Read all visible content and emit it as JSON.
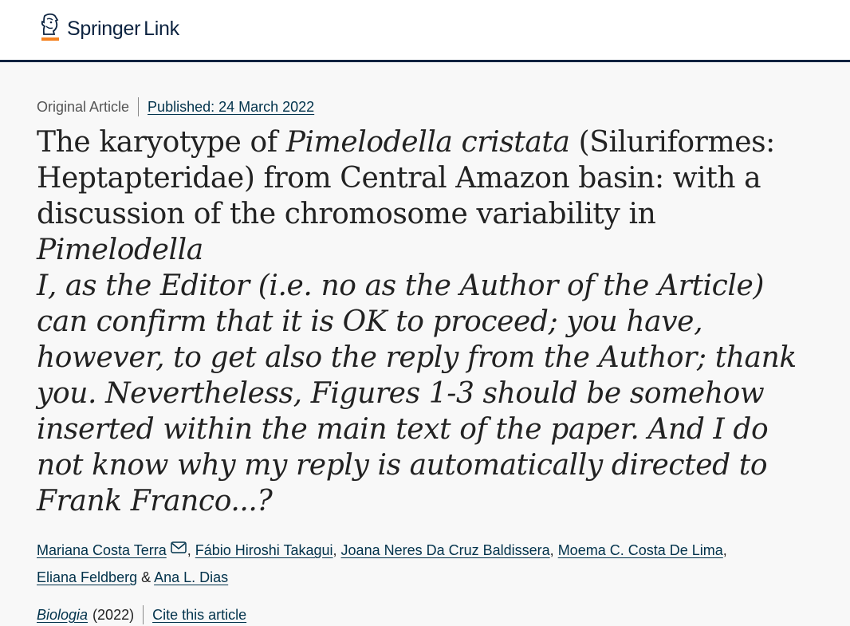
{
  "header": {
    "logo_brand": "Springer",
    "logo_suffix": "Link",
    "colors": {
      "navy": "#0c2340",
      "orange": "#f58220"
    }
  },
  "article": {
    "type": "Original Article",
    "published": "Published: 24 March 2022",
    "title_parts": {
      "p1": "The karyotype of ",
      "p2": "Pimelodella cristata",
      "p3": " (Siluriformes: Heptapteridae) from Central Amazon basin: with a discussion of the chromosome variability in ",
      "p4": "Pimelodella",
      "p5": "I, as the Editor (i.e. no as the Author of the Article) can confirm that it is OK to proceed; you have, however, to get also the reply from the Author; thank you. Nevertheless, Figures 1-3 should be somehow inserted within the main text of the paper. And I do not know why my reply is automatically directed to Frank Franco...?"
    },
    "authors": [
      "Mariana Costa Terra",
      "Fábio Hiroshi Takagui",
      "Joana Neres Da Cruz Baldissera",
      "Moema C. Costa De Lima",
      "Eliana Feldberg",
      "Ana L. Dias"
    ],
    "author_sep": ", ",
    "author_and": " & ",
    "journal": "Biologia",
    "year": "(2022)",
    "cite": "Cite this article",
    "icons": {
      "contact": "mail-icon",
      "logo": "springer-horse-icon"
    }
  }
}
